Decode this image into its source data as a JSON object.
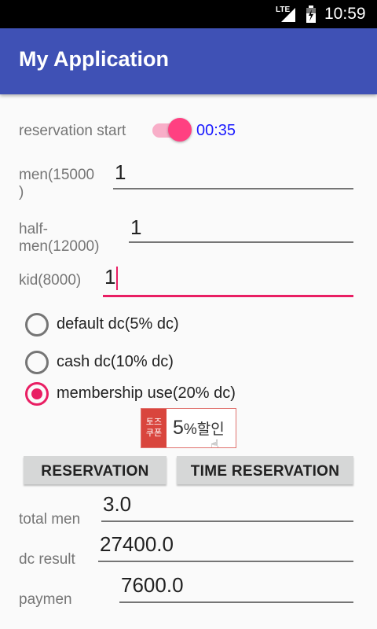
{
  "status_bar": {
    "network": "LTE",
    "time": "10:59"
  },
  "app_bar": {
    "title": "My Application"
  },
  "reservation": {
    "label": "reservation start",
    "timer": "00:35",
    "switch_on": true
  },
  "fields": {
    "men": {
      "label": "men(15000\n)",
      "value": "1"
    },
    "half_men": {
      "label": "half-\nmen(12000)",
      "value": "1"
    },
    "kid": {
      "label": "kid(8000)",
      "value": "1"
    }
  },
  "discount_options": [
    {
      "label": "default dc(5% dc)",
      "checked": false
    },
    {
      "label": "cash dc(10% dc)",
      "checked": false
    },
    {
      "label": "membership use(20% dc)",
      "checked": true
    }
  ],
  "coupon": {
    "left_text": "토즈\n쿠폰",
    "percent": "5",
    "percent_suffix": "%할인"
  },
  "buttons": {
    "reservation": "RESERVATION",
    "time_reservation": "TIME RESERVATION"
  },
  "results": {
    "total": {
      "label": "total men",
      "value": "3.0"
    },
    "dc": {
      "label": "dc result",
      "value": "27400.0"
    },
    "payment": {
      "label": "paymen",
      "value": "7600.0"
    }
  },
  "colors": {
    "primary": "#3f51b5",
    "accent": "#ff4081"
  }
}
